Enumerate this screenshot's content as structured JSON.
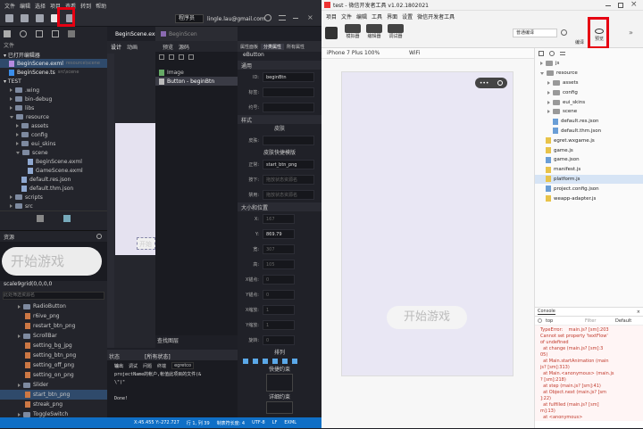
{
  "egret": {
    "menu": [
      "文件",
      "编辑",
      "选择",
      "项目",
      "查看",
      "转到",
      "帮助"
    ],
    "toolbar_dropdown": "程序员",
    "account": "lingle.lau@gmail.com",
    "files_header": "文件",
    "open_editors_label": "▾ 已打开编辑器",
    "open_editors": [
      {
        "name": "BeginScene.exml",
        "path": "resource\\scene"
      },
      {
        "name": "BeginScene.ts",
        "path": "src\\scene"
      }
    ],
    "project_label": "▾ TEST",
    "tree": [
      {
        "label": ".wing",
        "depth": 1,
        "type": "folder",
        "open": false
      },
      {
        "label": "bin-debug",
        "depth": 1,
        "type": "folder",
        "open": false
      },
      {
        "label": "libs",
        "depth": 1,
        "type": "folder",
        "open": false
      },
      {
        "label": "resource",
        "depth": 1,
        "type": "folder",
        "open": true
      },
      {
        "label": "assets",
        "depth": 2,
        "type": "folder",
        "open": false
      },
      {
        "label": "config",
        "depth": 2,
        "type": "folder",
        "open": false
      },
      {
        "label": "eui_skins",
        "depth": 2,
        "type": "folder",
        "open": false
      },
      {
        "label": "scene",
        "depth": 2,
        "type": "folder",
        "open": true
      },
      {
        "label": "BeginScene.exml",
        "depth": 3,
        "type": "file"
      },
      {
        "label": "GameScene.exml",
        "depth": 3,
        "type": "file"
      },
      {
        "label": "default.res.json",
        "depth": 2,
        "type": "file"
      },
      {
        "label": "default.thm.json",
        "depth": 2,
        "type": "file"
      },
      {
        "label": "scripts",
        "depth": 1,
        "type": "folder",
        "open": false
      },
      {
        "label": "src",
        "depth": 1,
        "type": "folder",
        "open": false
      }
    ],
    "resources_header": "资源",
    "preview_text": "开始游戏",
    "scale_label": "scale9grid(0,0,0,0",
    "filter_placeholder": "此处筛选资源名",
    "resources": [
      "RadioButton",
      "r6ive_png",
      "restart_btn_png",
      "ScrollBar",
      "setting_bg_jpg",
      "setting_btn_png",
      "setting_off_png",
      "setting_on_png",
      "Slider",
      "start_btn_png",
      "streak_png",
      "ToggleSwitch",
      "config"
    ],
    "selected_resource": "start_btn_png",
    "editor_tabs": [
      {
        "label": "BeginScene.exml",
        "active": true
      },
      {
        "label": "BeginScen",
        "active": false
      }
    ],
    "editor_subtabs": [
      "设计",
      "动画",
      "预览",
      "源码"
    ],
    "canvas_label": "开始",
    "layers": [
      "Image",
      "Button - beginBtn"
    ],
    "search_layers": "查找图层",
    "states_label": "状态",
    "all_states": "[所有状态]",
    "output_tabs": [
      "输出",
      "调试",
      "问题",
      "终端"
    ],
    "output_select": "egretco",
    "output_lines": [
      "projectName的帐户,帐值此项目的文件(& ",
      "\\\")\"",
      "",
      "Done!"
    ],
    "props_tabs": [
      "属性面板",
      "分类属性",
      "所有属性"
    ],
    "component": "eButton",
    "sections": {
      "general": "通用",
      "style": "样式",
      "size": "大小和位置",
      "arrange": "排列",
      "quick": "快捷约束",
      "detail": "详细约束"
    },
    "props": {
      "id_label": "ID:",
      "id": "beginBtn",
      "tag_label": "标签:",
      "label_label": "约号:",
      "skin_title": "皮肤",
      "skin_label": "皮肤:",
      "quick_skin": "皮肤快捷模版",
      "normal_label": "正常:",
      "normal": "start_btn_png",
      "down_label": "按下:",
      "down": "拖放状态资源名",
      "disabled_label": "禁用:",
      "disabled": "拖放状态资源名"
    },
    "size": [
      {
        "label": "X:",
        "value": "167"
      },
      {
        "label": "Y:",
        "value": "869.79"
      },
      {
        "label": "宽:",
        "value": "307"
      },
      {
        "label": "高:",
        "value": "105"
      },
      {
        "label": "X锚点:",
        "value": "0"
      },
      {
        "label": "Y锚点:",
        "value": "0"
      },
      {
        "label": "X缩放:",
        "value": "1"
      },
      {
        "label": "Y缩放:",
        "value": "1"
      },
      {
        "label": "旋转:",
        "value": "0"
      }
    ],
    "status": [
      "X:45.455 Y:-272.727",
      "行 1, 列 39",
      "制表符长度: 4",
      "UTF-8",
      "LF",
      "EXML"
    ]
  },
  "wechat": {
    "title": "test - 微信开发者工具 v1.02.1802021",
    "menu": [
      "项目",
      "文件",
      "编辑",
      "工具",
      "界面",
      "设置",
      "微信开发者工具"
    ],
    "tools": [
      "模拟器",
      "编辑器",
      "调试器"
    ],
    "compile_mode": "普通编译",
    "preview_label": "预览",
    "clear_label": "编译",
    "device": "iPhone 7 Plus",
    "zoom": "100%",
    "network": "WiFi",
    "start_button": "开始游戏",
    "files": [
      {
        "label": "js",
        "depth": 0,
        "type": "folder",
        "open": false
      },
      {
        "label": "resource",
        "depth": 0,
        "type": "folder",
        "open": true
      },
      {
        "label": "assets",
        "depth": 1,
        "type": "folder",
        "open": false
      },
      {
        "label": "config",
        "depth": 1,
        "type": "folder",
        "open": false
      },
      {
        "label": "eui_skins",
        "depth": 1,
        "type": "folder",
        "open": false
      },
      {
        "label": "scene",
        "depth": 1,
        "type": "folder",
        "open": false
      },
      {
        "label": "default.res.json",
        "depth": 1,
        "type": "json"
      },
      {
        "label": "default.thm.json",
        "depth": 1,
        "type": "json"
      },
      {
        "label": "egret.wxgame.js",
        "depth": 0,
        "type": "js"
      },
      {
        "label": "game.js",
        "depth": 0,
        "type": "js"
      },
      {
        "label": "game.json",
        "depth": 0,
        "type": "json"
      },
      {
        "label": "manifest.js",
        "depth": 0,
        "type": "js"
      },
      {
        "label": "platform.js",
        "depth": 0,
        "type": "js",
        "selected": true
      },
      {
        "label": "project.config.json",
        "depth": 0,
        "type": "json"
      },
      {
        "label": "weapp-adapter.js",
        "depth": 0,
        "type": "js"
      }
    ],
    "console_tab": "Console",
    "console_context": "top",
    "console_filter": "Filter",
    "console_level": "Default",
    "console_lines": [
      "TypeError:    main.js? [sm]:203",
      "Cannot set property 'textFlow'",
      "of undefined",
      "  at change (main.js? [sm]:3",
      "05)",
      "  at Main.startAnimation (main",
      "js? [sm]:313)",
      "  at Main.<anonymous> (main.js",
      "? [sm]:218)",
      "  at step (main.js? [sm]:41)",
      "  at Object.next (main.js? [sm",
      "]:22)",
      "  at fulfilled (main.js? [sm]",
      "m]:13)",
      "  at <anonymous>"
    ]
  },
  "colors": {
    "highlight": "#e60012",
    "egret_bg": "#1e1f26",
    "status_bar": "#0f6fc6"
  }
}
